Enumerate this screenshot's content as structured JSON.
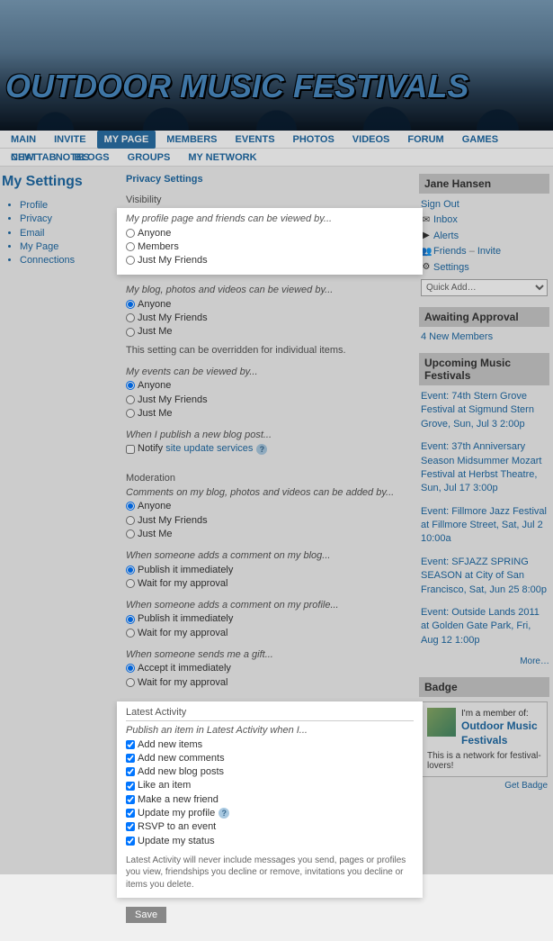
{
  "site_title": "OUTDOOR MUSIC FESTIVALS",
  "nav1": [
    "MAIN",
    "INVITE",
    "MY PAGE",
    "MEMBERS",
    "EVENTS",
    "PHOTOS",
    "VIDEOS",
    "FORUM",
    "GAMES",
    "CHAT",
    "NOTES"
  ],
  "nav1_active": 2,
  "nav2": [
    "NEW TAB",
    "BLOGS",
    "GROUPS",
    "MY NETWORK"
  ],
  "page_title": "My Settings",
  "left_nav": [
    "Profile",
    "Privacy",
    "Email",
    "My Page",
    "Connections"
  ],
  "privacy": {
    "heading": "Privacy Settings",
    "visibility_label": "Visibility",
    "q_profile": "My profile page and friends can be viewed by...",
    "opt_profile": [
      "Anyone",
      "Members",
      "Just My Friends"
    ],
    "q_blog": "My blog, photos and videos can be viewed by...",
    "opt_blog": [
      "Anyone",
      "Just My Friends",
      "Just Me"
    ],
    "note_override": "This setting can be overridden for individual items.",
    "q_events": "My events can be viewed by...",
    "opt_events": [
      "Anyone",
      "Just My Friends",
      "Just Me"
    ],
    "q_publish": "When I publish a new blog post...",
    "chk_notify": "Notify ",
    "notify_link": "site update services",
    "moderation_label": "Moderation",
    "q_comments": "Comments on my blog, photos and videos can be added by...",
    "opt_comments": [
      "Anyone",
      "Just My Friends",
      "Just Me"
    ],
    "q_blogcomment": "When someone adds a comment on my blog...",
    "opt_blogcomment": [
      "Publish it immediately",
      "Wait for my approval"
    ],
    "q_profcomment": "When someone adds a comment on my profile...",
    "opt_profcomment": [
      "Publish it immediately",
      "Wait for my approval"
    ],
    "q_gift": "When someone sends me a gift...",
    "opt_gift": [
      "Accept it immediately",
      "Wait for my approval"
    ],
    "latest_label": "Latest Activity",
    "q_latest": "Publish an item in Latest Activity when I...",
    "chk_latest": [
      "Add new items",
      "Add new comments",
      "Add new blog posts",
      "Like an item",
      "Make a new friend",
      "Update my profile",
      "RSVP to an event",
      "Update my status"
    ],
    "chk_latest_help_index": 5,
    "latest_footer": "Latest Activity will never include messages you send, pages or profiles you view, friendships you decline or remove, invitations you decline or items you delete.",
    "save": "Save"
  },
  "sidebar": {
    "username": "Jane Hansen",
    "signout": "Sign Out",
    "inbox": "Inbox",
    "alerts": "Alerts",
    "friends": "Friends",
    "invite": "Invite",
    "settings": "Settings",
    "quickadd": "Quick Add…",
    "awaiting_head": "Awaiting Approval",
    "awaiting_link": "4 New Members",
    "upcoming_head": "Upcoming Music Festivals",
    "events": [
      "Event: 74th Stern Grove Festival at Sigmund Stern Grove, Sun, Jul 3 2:00p",
      "Event: 37th Anniversary Season Midsummer Mozart Festival at Herbst Theatre, Sun, Jul 17 3:00p",
      "Event: Fillmore Jazz Festival at Fillmore Street, Sat, Jul 2 10:00a",
      "Event: SFJAZZ SPRING SEASON at City of San Francisco, Sat, Jun 25 8:00p",
      "Event: Outside Lands 2011 at Golden Gate Park, Fri, Aug 12 1:00p"
    ],
    "more": "More…",
    "badge_head": "Badge",
    "badge_member_of": "I'm a member of:",
    "badge_title": "Outdoor Music Festivals",
    "badge_desc": "This is a network for festival-lovers!",
    "get_badge": "Get Badge"
  }
}
